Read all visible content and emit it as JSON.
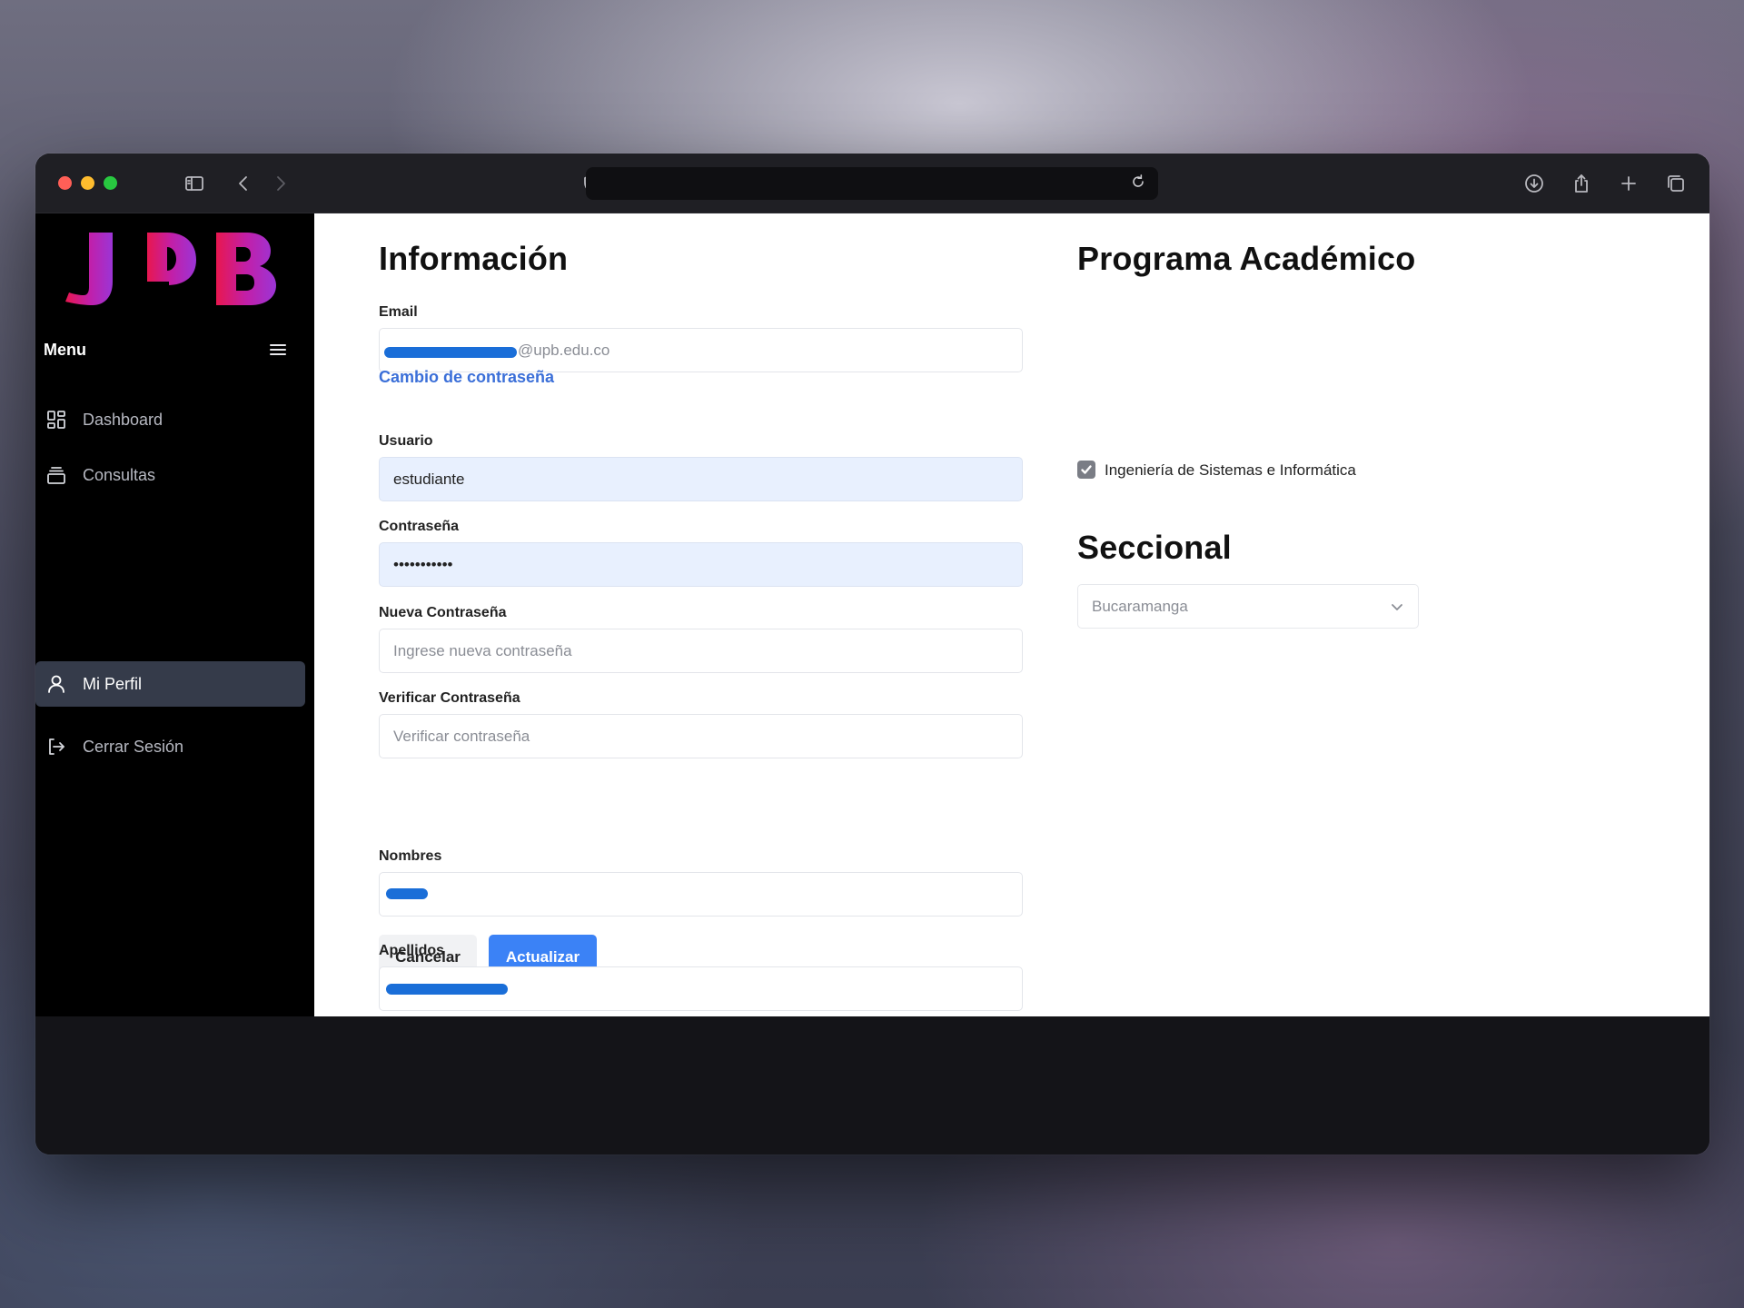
{
  "browser": {
    "url": ""
  },
  "sidebar": {
    "logo_text": "UPB",
    "menu_title": "Menu",
    "items": [
      {
        "label": "Dashboard",
        "icon": "dashboard-grid-icon",
        "active": false
      },
      {
        "label": "Consultas",
        "icon": "stack-icon",
        "active": false
      },
      {
        "label": "Mi Perfil",
        "icon": "user-icon",
        "active": true
      },
      {
        "label": "Cerrar Sesión",
        "icon": "logout-icon",
        "active": false
      }
    ]
  },
  "info": {
    "title": "Información",
    "email": {
      "label": "Email",
      "value": "@upb.edu.co"
    },
    "password_change_heading": "Cambio de contraseña",
    "usuario": {
      "label": "Usuario",
      "value": "estudiante"
    },
    "contrasena": {
      "label": "Contraseña",
      "value": "•••••••••••"
    },
    "nueva": {
      "label": "Nueva Contraseña",
      "placeholder": "Ingrese nueva contraseña"
    },
    "verificar": {
      "label": "Verificar Contraseña",
      "placeholder": "Verificar contraseña"
    },
    "cancel_label": "Cancelar",
    "update_label": "Actualizar",
    "nombres": {
      "label": "Nombres",
      "value": ""
    },
    "apellidos": {
      "label": "Apellidos",
      "value": ""
    }
  },
  "programa": {
    "title": "Programa Académico",
    "option": "Ingeniería de Sistemas e Informática",
    "checked": true
  },
  "seccional": {
    "title": "Seccional",
    "selected": "Bucaramanga"
  },
  "colors": {
    "accent": "#3b82f6",
    "link": "#3b6fd8",
    "sidebar_bg": "#000000",
    "active_item_bg": "#353b4a",
    "redaction": "#1a6ed8"
  }
}
